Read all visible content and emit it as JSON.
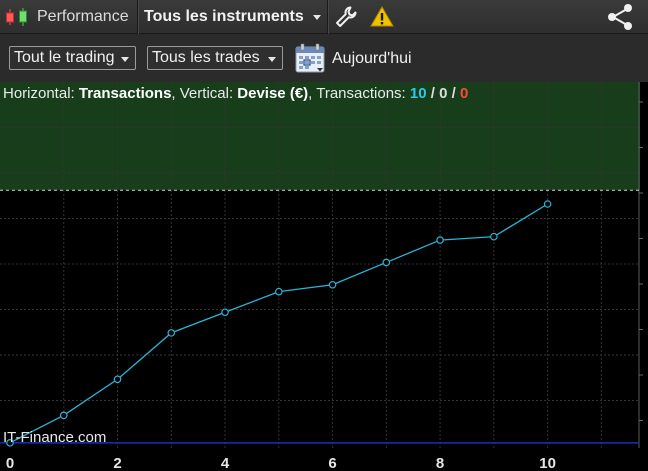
{
  "topbar": {
    "title": "Performance",
    "instrument": "Tous les instruments",
    "icons": [
      "candlestick-icon",
      "wrench-icon",
      "warning-icon",
      "share-icon"
    ]
  },
  "toolbar": {
    "filter_trading": "Tout le trading",
    "filter_trades": "Tous les trades",
    "period_label": "Aujourd'hui",
    "icons": [
      "calendar-icon"
    ]
  },
  "chart_caption": {
    "h_label": "Horizontal: ",
    "h_value": "Transactions",
    "v_label": ", Vertical: ",
    "v_value": "Devise (€)",
    "t_label": ", Transactions: ",
    "count_total": "10",
    "count_sep1": " / ",
    "count_even": "0",
    "count_sep2": " / ",
    "count_loss": "0"
  },
  "watermark": "IT-Finance.com",
  "colors": {
    "profit_zone": "#173d1b",
    "line": "#2ab4d8",
    "zero_line": "#1a2ec0",
    "count_total": "#2ec8f0",
    "count_loss": "#ff4a3a"
  },
  "chart_data": {
    "type": "line",
    "xlabel": "",
    "ylabel": "",
    "x_ticks": [
      "0",
      "2",
      "4",
      "6",
      "8",
      "10"
    ],
    "x_range": [
      0,
      11.7
    ],
    "y_range": [
      -0.15,
      10.5
    ],
    "zero_level": 0,
    "target_level": 7.35,
    "grid": true,
    "series": [
      {
        "x": [
          0,
          1,
          2,
          3,
          4,
          5,
          6,
          7,
          8,
          9,
          10
        ],
        "y": [
          0,
          0.8,
          1.85,
          3.2,
          3.8,
          4.4,
          4.6,
          5.25,
          5.9,
          6.0,
          6.95
        ]
      }
    ]
  }
}
